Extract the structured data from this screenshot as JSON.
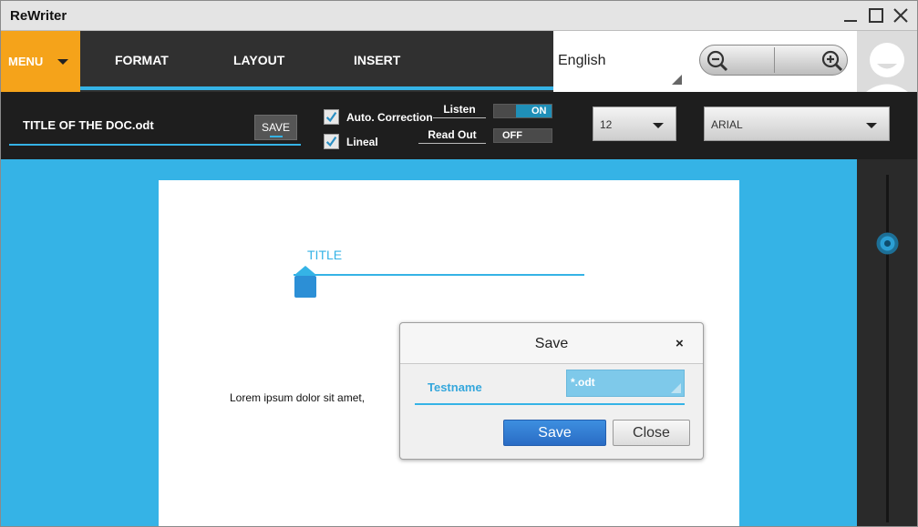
{
  "window": {
    "title": "ReWriter"
  },
  "menubar": {
    "menu_label": "MENU",
    "tabs": [
      "FORMAT",
      "LAYOUT",
      "INSERT"
    ],
    "language": "English"
  },
  "toolbar": {
    "document_name": "TITLE OF THE DOC.odt",
    "save_label": "SAVE",
    "checkboxes": [
      {
        "label": "Auto. Correction",
        "checked": true
      },
      {
        "label": "Lineal",
        "checked": true
      }
    ],
    "switches": [
      {
        "label": "Listen",
        "state": "ON"
      },
      {
        "label": "Read Out",
        "state": "OFF"
      }
    ],
    "font_size": "12",
    "font_family": "ARIAL"
  },
  "document": {
    "title_placeholder": "TITLE",
    "body_text": "Lorem ipsum dolor sit amet,"
  },
  "save_dialog": {
    "title": "Save",
    "close_glyph": "×",
    "filename": "Testname",
    "extension": "*.odt",
    "save_button": "Save",
    "close_button": "Close"
  },
  "colors": {
    "accent_blue": "#35b3e6",
    "menu_orange": "#f5a31a",
    "dark_bar": "#303030"
  }
}
